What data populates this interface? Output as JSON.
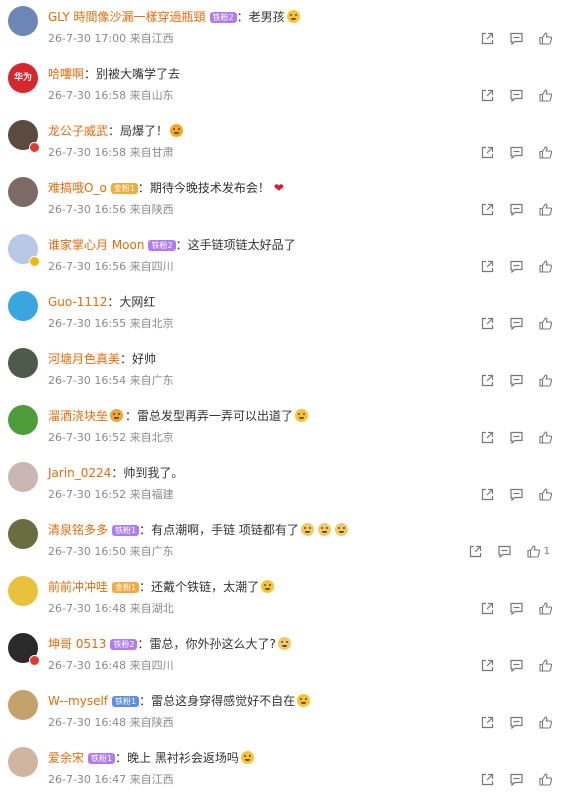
{
  "comments": [
    {
      "name": "GLY 時間像沙漏一樣穿過瓶頸",
      "badge": "铁粉2",
      "badge_color": "#b07cf2",
      "text": "：老男孩",
      "emoji": "laugh-emoji",
      "time": "26-7-30 17:00",
      "from": "来自江西",
      "avatar_text": "",
      "avatar_color": "#6c86b6"
    },
    {
      "name": "哈嘍啊",
      "badge": "",
      "badge_color": "",
      "text": "：别被大嘴学了去",
      "emoji": "",
      "time": "26-7-30 16:58",
      "from": "来自山东",
      "avatar_text": "华为",
      "avatar_color": "#d8262d"
    },
    {
      "name": "龙公子威武",
      "badge": "",
      "badge_color": "",
      "text": "：局爆了！",
      "emoji": "cat-emoji",
      "time": "26-7-30 16:58",
      "from": "来自甘肃",
      "avatar_text": "",
      "avatar_color": "#5a4a40"
    },
    {
      "name": "难搞哦O_o",
      "badge": "金粉1",
      "badge_color": "#f3a93b",
      "text": "：期待今晚技术发布会！",
      "emoji": "heart-emoji",
      "time": "26-7-30 16:56",
      "from": "来自陕西",
      "avatar_text": "",
      "avatar_color": "#7b6a66"
    },
    {
      "name": "谁家掌心月 Moon",
      "badge": "铁粉2",
      "badge_color": "#b07cf2",
      "text": "：这手链项链太好品了",
      "emoji": "",
      "time": "26-7-30 16:56",
      "from": "来自四川",
      "avatar_text": "",
      "avatar_color": "#b8c8e6"
    },
    {
      "name": "Guo-1112",
      "badge": "",
      "badge_color": "",
      "text": "：大网红",
      "emoji": "",
      "time": "26-7-30 16:55",
      "from": "来自北京",
      "avatar_text": "",
      "avatar_color": "#3aa6e0"
    },
    {
      "name": "河塘月色真美",
      "badge": "",
      "badge_color": "",
      "text": "：好帅",
      "emoji": "",
      "time": "26-7-30 16:54",
      "from": "来自广东",
      "avatar_text": "",
      "avatar_color": "#4d5a4c"
    },
    {
      "name": "溜酒浇块垒",
      "badge": "",
      "badge_color": "",
      "text": "：雷总发型再弄一弄可以出道了",
      "emoji": "laugh-emoji",
      "time": "26-7-30 16:52",
      "from": "来自北京",
      "avatar_text": "",
      "avatar_color": "#4f9c3c"
    },
    {
      "name": "Jarin_0224",
      "badge": "",
      "badge_color": "",
      "text": "：帅到我了。",
      "emoji": "",
      "time": "26-7-30 16:52",
      "from": "来自福建",
      "avatar_text": "",
      "avatar_color": "#c9b7b3"
    },
    {
      "name": "清泉铭多多",
      "badge": "铁粉1",
      "badge_color": "#b07cf2",
      "text": "：有点潮啊，手链 项链都有了",
      "emoji": "dog-emoji-x3",
      "time": "26-7-30 16:50",
      "from": "来自广东",
      "avatar_text": "",
      "avatar_color": "#6a6d3e",
      "likes": "1"
    },
    {
      "name": "前前冲冲哇",
      "badge": "金粉1",
      "badge_color": "#f3a93b",
      "text": "：还戴个铁链，太潮了",
      "emoji": "laugh-emoji",
      "time": "26-7-30 16:48",
      "from": "来自湖北",
      "avatar_text": "",
      "avatar_color": "#e8c23a"
    },
    {
      "name": "坤哥 0513",
      "badge": "铁粉2",
      "badge_color": "#b07cf2",
      "text": "：雷总，你外孙这么大了?",
      "emoji": "dog-emoji",
      "time": "26-7-30 16:48",
      "from": "来自四川",
      "avatar_text": "",
      "avatar_color": "#2a2a2a"
    },
    {
      "name": "W--myself",
      "badge": "铁粉1",
      "badge_color": "#5b8ee6",
      "text": "：雷总这身穿得感觉好不自在",
      "emoji": "laugh-emoji",
      "time": "26-7-30 16:48",
      "from": "来自陕西",
      "avatar_text": "",
      "avatar_color": "#c3a36b"
    },
    {
      "name": "爱余宋",
      "badge": "铁粉1",
      "badge_color": "#b07cf2",
      "text": "：晚上 黑衬衫会返场吗",
      "emoji": "smile-emoji",
      "time": "26-7-30 16:47",
      "from": "来自江西",
      "avatar_text": "",
      "avatar_color": "#d0b6a0"
    }
  ]
}
